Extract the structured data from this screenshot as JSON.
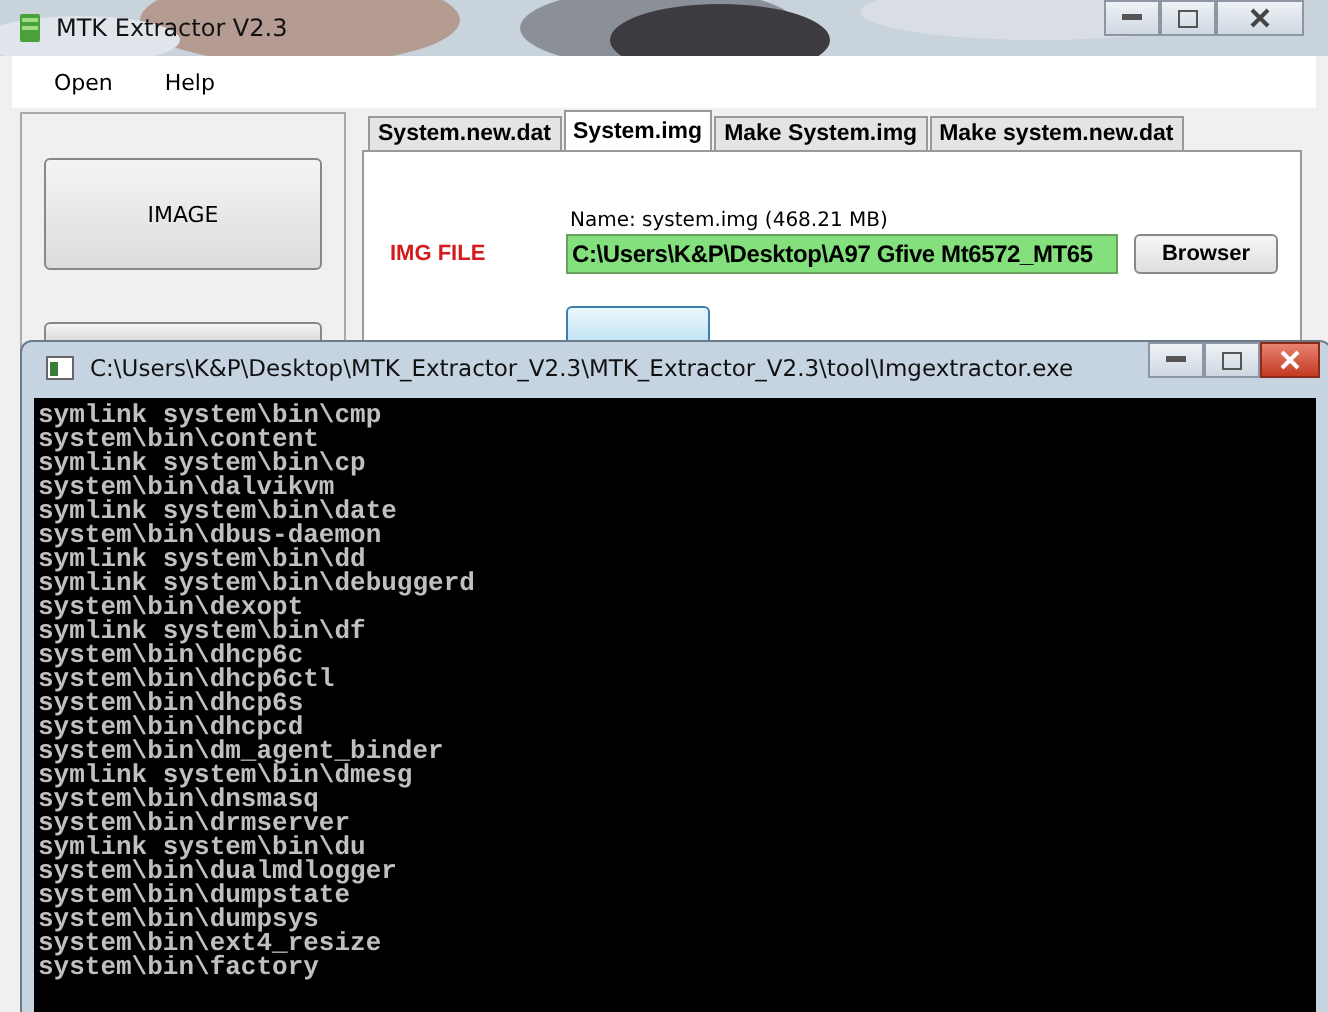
{
  "window": {
    "title": "MTK Extractor V2.3"
  },
  "menu": [
    "Open",
    "Help"
  ],
  "sidebar": {
    "buttons": [
      "IMAGE"
    ]
  },
  "tabs": [
    {
      "label": "System.new.dat",
      "selected": false
    },
    {
      "label": "System.img",
      "selected": true
    },
    {
      "label": "Make System.img",
      "selected": false
    },
    {
      "label": "Make system.new.dat",
      "selected": false
    }
  ],
  "form": {
    "name_label": "Name: system.img (468.21 MB)",
    "field_label": "IMG FILE",
    "path": "C:\\Users\\K&P\\Desktop\\A97 Gfive Mt6572_MT65",
    "browse_button": "Browser"
  },
  "console": {
    "title": "C:\\Users\\K&P\\Desktop\\MTK_Extractor_V2.3\\MTK_Extractor_V2.3\\tool\\Imgextractor.exe",
    "lines": [
      "symlink system\\bin\\cmp",
      "system\\bin\\content",
      "symlink system\\bin\\cp",
      "system\\bin\\dalvikvm",
      "symlink system\\bin\\date",
      "system\\bin\\dbus-daemon",
      "symlink system\\bin\\dd",
      "symlink system\\bin\\debuggerd",
      "system\\bin\\dexopt",
      "symlink system\\bin\\df",
      "system\\bin\\dhcp6c",
      "system\\bin\\dhcp6ctl",
      "system\\bin\\dhcp6s",
      "system\\bin\\dhcpcd",
      "system\\bin\\dm_agent_binder",
      "symlink system\\bin\\dmesg",
      "system\\bin\\dnsmasq",
      "system\\bin\\drmserver",
      "symlink system\\bin\\du",
      "system\\bin\\dualmdlogger",
      "system\\bin\\dumpstate",
      "system\\bin\\dumpsys",
      "system\\bin\\ext4_resize",
      "system\\bin\\factory"
    ]
  }
}
